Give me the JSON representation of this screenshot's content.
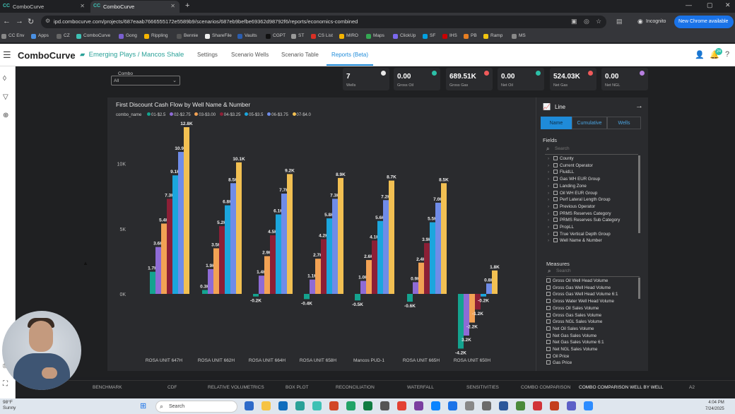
{
  "browser": {
    "tabs": [
      {
        "label": "ComboCurve",
        "active": false
      },
      {
        "label": "ComboCurve",
        "active": true
      }
    ],
    "url": "ipd.combocurve.com/projects/687eaab7666555172e5589b9/scenarios/687eb9befbe69362d98792f6/reports/economics-combined",
    "incognito_label": "Incognito",
    "new_chrome_label": "New Chrome available",
    "bookmarks": [
      "CC Env",
      "Apps",
      "CZ",
      "ComboCurve",
      "Gong",
      "Rippling",
      "Bennie",
      "ShareFile",
      "Vaults",
      "CGPT",
      "ST",
      "CS List",
      "MIRO",
      "Maps",
      "ClickUp",
      "SF",
      "IHS",
      "PB",
      "Ramp",
      "MS"
    ]
  },
  "app": {
    "brand": "ComboCurve",
    "breadcrumb": {
      "project": "Emerging Plays",
      "separator": "/",
      "scenario": "Mancos Shale"
    },
    "nav_tabs": [
      {
        "label": "Settings",
        "active": false
      },
      {
        "label": "Scenario Wells",
        "active": false
      },
      {
        "label": "Scenario Table",
        "active": false
      },
      {
        "label": "Reports (Beta)",
        "active": true
      }
    ],
    "notification_count": "24"
  },
  "filter": {
    "label": "Combo",
    "value": "All"
  },
  "kpis": [
    {
      "value": "7",
      "label": "Wells",
      "color": "#e8e8e8"
    },
    {
      "value": "0.00",
      "label": "Gross Oil",
      "color": "#2cc0a8"
    },
    {
      "value": "689.51K",
      "label": "Gross Gas",
      "color": "#f05a5a"
    },
    {
      "value": "0.00",
      "label": "Net Oil",
      "color": "#2cc0a8"
    },
    {
      "value": "524.03K",
      "label": "Net Gas",
      "color": "#f05a5a"
    },
    {
      "value": "0.00",
      "label": "Net NGL",
      "color": "#b77fe0"
    }
  ],
  "chart": {
    "title": "First Discount Cash Flow by Well Name & Number",
    "legend_title": "combo_name"
  },
  "chart_data": {
    "type": "bar",
    "title": "First Discount Cash Flow by Well Name & Number",
    "categories": [
      "ROSA UNIT 647H",
      "ROSA UNIT 662H",
      "ROSA UNIT 664H",
      "ROSA UNIT 658H",
      "Mancos PUD-1",
      "ROSA UNIT 665H",
      "ROSA UNIT 650H"
    ],
    "series": [
      {
        "name": "01-$2.5",
        "color": "#14a38f",
        "values": [
          1700,
          300,
          -200,
          -400,
          -500,
          -600,
          -4200
        ]
      },
      {
        "name": "02-$2.75",
        "color": "#8e6bd6",
        "values": [
          3600,
          1900,
          1400,
          1100,
          1000,
          900,
          -3200
        ]
      },
      {
        "name": "03-$3.00",
        "color": "#f2a254",
        "values": [
          5400,
          3500,
          2900,
          2700,
          2600,
          2400,
          -2200
        ]
      },
      {
        "name": "04-$3.25",
        "color": "#8c1f36",
        "values": [
          7300,
          5200,
          4500,
          4200,
          4100,
          3900,
          -1200
        ]
      },
      {
        "name": "05-$3.5",
        "color": "#1ba6dd",
        "values": [
          9100,
          6800,
          6100,
          5800,
          5600,
          5500,
          -200
        ]
      },
      {
        "name": "06-$3.75",
        "color": "#6f8ce8",
        "values": [
          10900,
          8500,
          7700,
          7300,
          7200,
          7000,
          800
        ]
      },
      {
        "name": "07-$4.0",
        "color": "#f2c052",
        "values": [
          12800,
          10100,
          9200,
          8900,
          8700,
          8500,
          1800
        ]
      }
    ],
    "data_labels": [
      [
        "1.7K",
        "0.3K",
        "-0.2K",
        "-0.4K",
        "-0.5K",
        "-0.6K",
        "-4.2K"
      ],
      [
        "3.6K",
        "1.9K",
        "1.4K",
        "1.1K",
        "1.0K",
        "0.9K",
        "3.2K"
      ],
      [
        "5.4K",
        "3.5K",
        "2.9K",
        "2.7K",
        "2.6K",
        "2.4K",
        "-2.2K"
      ],
      [
        "7.3K",
        "5.2K",
        "4.5K",
        "4.2K",
        "4.1K",
        "3.9K",
        "-1.2K"
      ],
      [
        "9.1K",
        "6.8K",
        "6.1K",
        "5.8K",
        "5.6K",
        "5.5K",
        "-0.2K"
      ],
      [
        "10.9K",
        "8.5K",
        "7.7K",
        "7.3K",
        "7.2K",
        "7.0K",
        "0.8K"
      ],
      [
        "12.8K",
        "10.1K",
        "9.2K",
        "8.9K",
        "8.7K",
        "8.5K",
        "1.8K"
      ]
    ],
    "y_ticks": [
      0,
      5000,
      10000
    ],
    "y_tick_labels": [
      "0K",
      "5K",
      "10K"
    ],
    "ylim": [
      -4500,
      13000
    ],
    "legend_position": "top-left"
  },
  "side_panel": {
    "title": "Line",
    "segments": [
      {
        "label": "Name",
        "active": true
      },
      {
        "label": "Cumulative",
        "active": false
      },
      {
        "label": "Wells",
        "active": false
      }
    ],
    "fields_label": "Fields",
    "fields_search_placeholder": "Search",
    "fields": [
      "County",
      "Current Operator",
      "FluidLL",
      "Gas WH EUR Group",
      "Landing Zone",
      "Oil WH EUR Group",
      "Perf Lateral Length Group",
      "Previous Operator",
      "PRMS Reserves Category",
      "PRMS Reserves Sub Category",
      "PropLL",
      "True Vertical Depth Group",
      "Well Name & Number"
    ],
    "measures_label": "Measures",
    "measures_search_placeholder": "Search",
    "measures": [
      "Gross Oil Well Head Volume",
      "Gross Gas Well Head Volume",
      "Gross Gas Well Head Volume 6:1",
      "Gross Water Well Head Volume",
      "Gross Oil Sales Volume",
      "Gross Gas Sales Volume",
      "Gross NGL Sales Volume",
      "Net Oil Sales Volume",
      "Net Gas Sales Volume",
      "Net Gas Sales Volume 6:1",
      "Net NGL Sales Volume",
      "Oil Price",
      "Gas Price"
    ]
  },
  "bottom_tabs": [
    {
      "label": "BENCHMARK",
      "active": false
    },
    {
      "label": "CDF",
      "active": false
    },
    {
      "label": "RELATIVE VOLUMETRICS",
      "active": false
    },
    {
      "label": "BOX PLOT",
      "active": false
    },
    {
      "label": "RECONCILIATION",
      "active": false
    },
    {
      "label": "WATERFALL",
      "active": false
    },
    {
      "label": "SENSITIVITIES",
      "active": false
    },
    {
      "label": "COMBO COMPARISON",
      "active": false
    },
    {
      "label": "COMBO COMPARISON WELL BY WELL",
      "active": true
    },
    {
      "label": "A2",
      "active": false
    }
  ],
  "taskbar": {
    "weather_temp": "98°F",
    "weather_desc": "Sunny",
    "search_placeholder": "Search",
    "time": "4:04 PM",
    "date": "7/24/2025"
  }
}
